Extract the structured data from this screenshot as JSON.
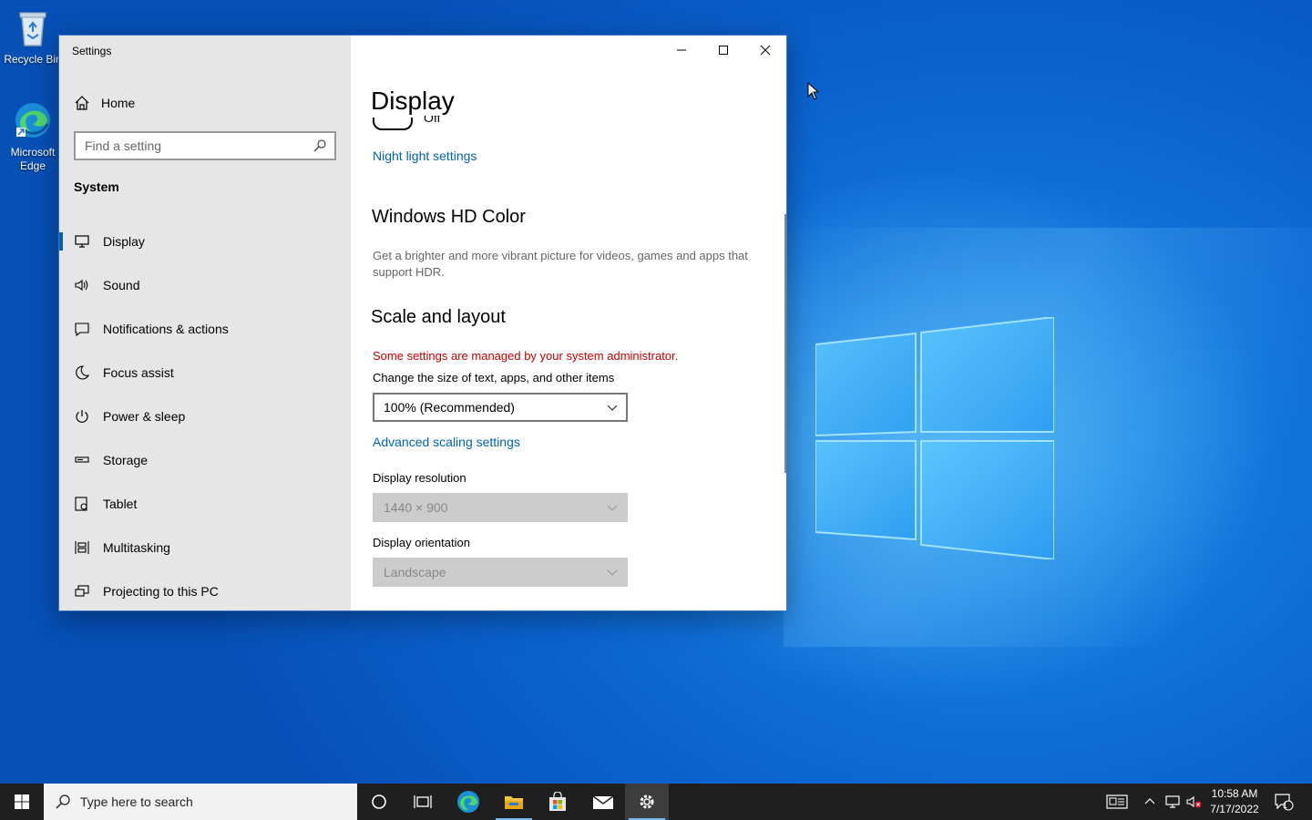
{
  "desktop": {
    "icons": [
      {
        "label": "Recycle Bin"
      },
      {
        "label": "Microsoft Edge"
      }
    ]
  },
  "window": {
    "title": "Settings",
    "controls": {
      "minimize": "minimize",
      "maximize": "maximize",
      "close": "close"
    }
  },
  "nav": {
    "home_label": "Home",
    "search_placeholder": "Find a setting",
    "section_label": "System",
    "items": [
      {
        "label": "Display",
        "icon": "monitor-icon",
        "active": true
      },
      {
        "label": "Sound",
        "icon": "speaker-icon"
      },
      {
        "label": "Notifications & actions",
        "icon": "notification-icon"
      },
      {
        "label": "Focus assist",
        "icon": "moon-icon"
      },
      {
        "label": "Power & sleep",
        "icon": "power-icon"
      },
      {
        "label": "Storage",
        "icon": "storage-icon"
      },
      {
        "label": "Tablet",
        "icon": "tablet-icon"
      },
      {
        "label": "Multitasking",
        "icon": "multitasking-icon"
      },
      {
        "label": "Projecting to this PC",
        "icon": "projecting-icon"
      }
    ]
  },
  "content": {
    "page_title": "Display",
    "toggle_state": "Off",
    "night_light_link": "Night light settings",
    "hd_color": {
      "heading": "Windows HD Color",
      "description": "Get a brighter and more vibrant picture for videos, games and apps that support HDR."
    },
    "scale_layout": {
      "heading": "Scale and layout",
      "warning": "Some settings are managed by your system administrator.",
      "size_label": "Change the size of text, apps, and other items",
      "size_value": "100% (Recommended)",
      "advanced_link": "Advanced scaling settings",
      "resolution_label": "Display resolution",
      "resolution_value": "1440 × 900",
      "orientation_label": "Display orientation",
      "orientation_value": "Landscape"
    }
  },
  "taskbar": {
    "search_placeholder": "Type here to search",
    "time": "10:58 AM",
    "date": "7/17/2022",
    "notification_count": "1"
  },
  "colors": {
    "accent": "#0063b1",
    "warning": "#c40000",
    "taskbar": "#1f1f1f"
  }
}
